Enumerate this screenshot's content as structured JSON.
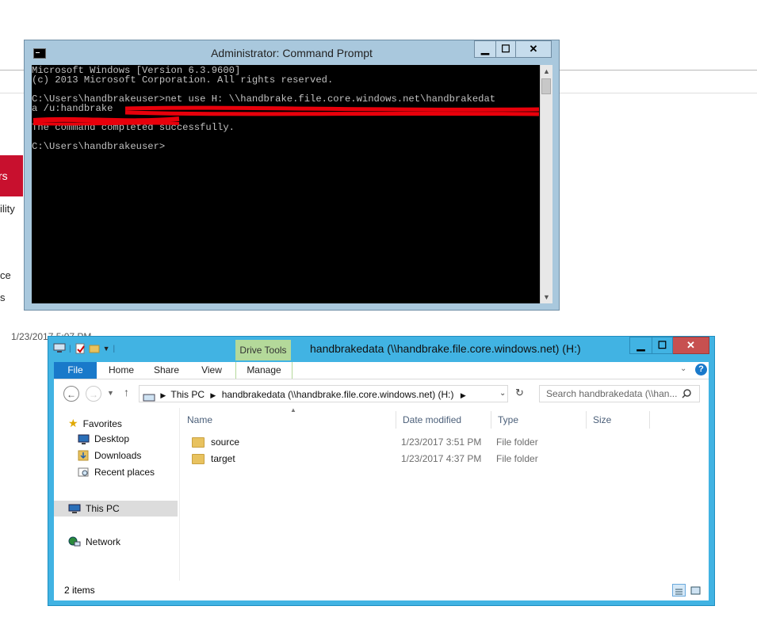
{
  "background_window": {
    "red_text": "rs",
    "text_lines": [
      "ility",
      "ce",
      "s"
    ],
    "date": "1/23/2017 5:07 PM"
  },
  "cmd": {
    "title": "Administrator: Command Prompt",
    "lines": [
      "Microsoft Windows [Version 6.3.9600]",
      "(c) 2013 Microsoft Corporation. All rights reserved.",
      "",
      "C:\\Users\\handbrakeuser>net use H: \\\\handbrake.file.core.windows.net\\handbrakedat",
      "a /u:handbrake",
      "",
      "The command completed successfully.",
      "",
      "C:\\Users\\handbrakeuser>"
    ],
    "controls": {
      "minimize": "▁",
      "maximize": "☐",
      "close": "✕"
    }
  },
  "explorer": {
    "title": "handbrakedata (\\\\handbrake.file.core.windows.net) (H:)",
    "contextual_tab": "Drive Tools",
    "controls": {
      "minimize": "▁",
      "maximize": "☐",
      "close": "✕"
    },
    "ribbon_tabs": [
      "File",
      "Home",
      "Share",
      "View",
      "Manage"
    ],
    "address": {
      "root": "This PC",
      "location": "handbrakedata (\\\\handbrake.file.core.windows.net) (H:)"
    },
    "search_placeholder": "Search handbrakedata (\\\\han...",
    "nav": {
      "favorites": "Favorites",
      "items": [
        "Desktop",
        "Downloads",
        "Recent places"
      ],
      "this_pc": "This PC",
      "network": "Network"
    },
    "columns": [
      "Name",
      "Date modified",
      "Type",
      "Size"
    ],
    "files": [
      {
        "name": "source",
        "date": "1/23/2017 3:51 PM",
        "type": "File folder",
        "size": ""
      },
      {
        "name": "target",
        "date": "1/23/2017 4:37 PM",
        "type": "File folder",
        "size": ""
      }
    ],
    "status": "2 items"
  },
  "colors": {
    "cmd_frame": "#a9c8dd",
    "explorer_frame": "#41b3e3",
    "file_tab": "#1979ca",
    "drive_tools": "#b4d99a",
    "close_button": "#c75050",
    "redaction": "#e8000b"
  },
  "icons": [
    "cmd-icon",
    "computer-icon",
    "folder-icon",
    "help-icon",
    "refresh-icon",
    "search-icon",
    "star-icon",
    "network-icon",
    "back-icon",
    "forward-icon"
  ]
}
